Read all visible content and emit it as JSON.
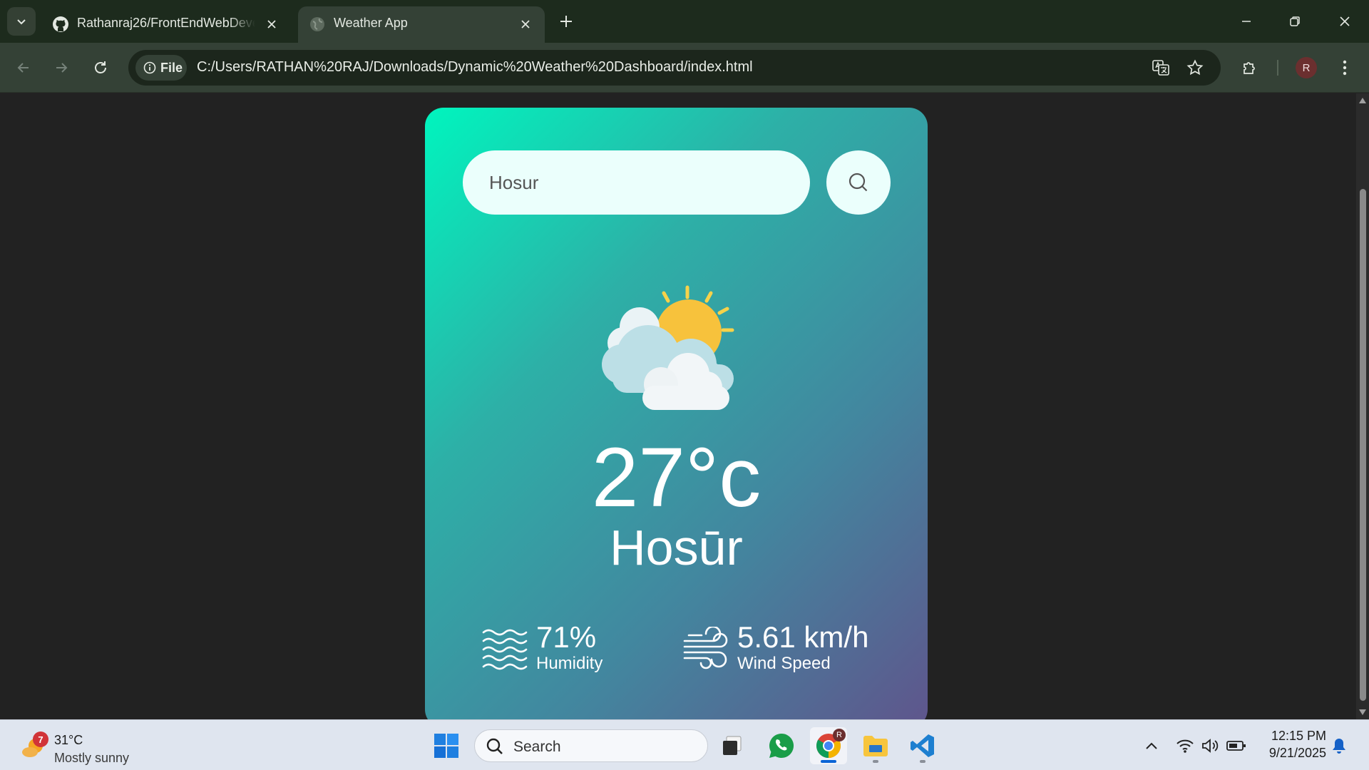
{
  "browser": {
    "tabs": [
      {
        "title": "Rathanraj26/FrontEndWebDeve",
        "favicon": "github-icon",
        "active": false
      },
      {
        "title": "Weather App",
        "favicon": "globe-icon",
        "active": true
      }
    ],
    "site_info_label": "File",
    "url": "C:/Users/RATHAN%20RAJ/Downloads/Dynamic%20Weather%20Dashboard/index.html",
    "profile_initial": "R"
  },
  "app": {
    "search_value": "Hosur",
    "weather_icon": "partly-cloudy-icon",
    "temperature": "27°c",
    "city": "Hosūr",
    "humidity": {
      "value": "71%",
      "label": "Humidity",
      "icon": "humidity-waves-icon"
    },
    "wind": {
      "value": "5.61 km/h",
      "label": "Wind Speed",
      "icon": "wind-icon"
    }
  },
  "taskbar": {
    "weather": {
      "badge": "7",
      "temp": "31°C",
      "desc": "Mostly sunny"
    },
    "search_label": "Search",
    "apps": [
      "windows-start-icon",
      "task-view-icon",
      "whatsapp-icon",
      "chrome-icon",
      "file-explorer-icon",
      "vscode-icon"
    ],
    "chrome_badge": "R",
    "time": "12:15 PM",
    "date": "9/21/2025"
  },
  "colors": {
    "card_gradient": [
      "#00f5be",
      "#2db0a7",
      "#42879f",
      "#5f558c"
    ],
    "browser_frame": "#1d2b1d",
    "page_bg": "#222222"
  }
}
